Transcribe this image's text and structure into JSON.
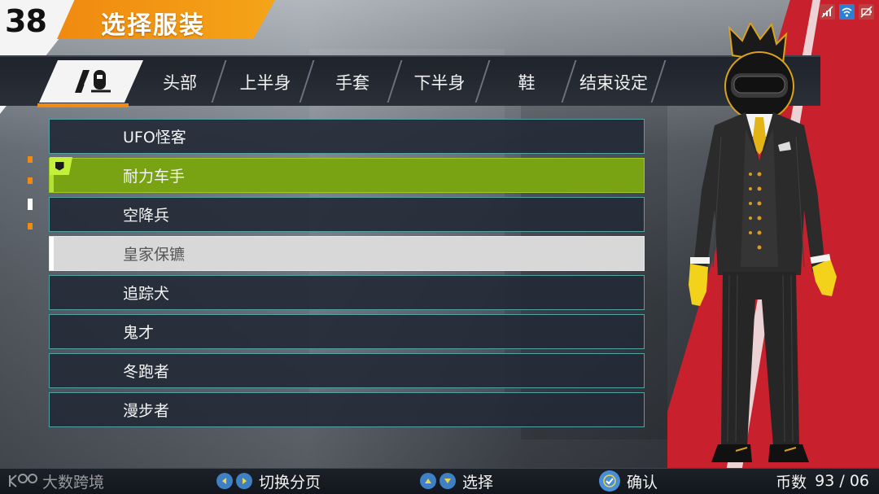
{
  "header": {
    "level": "38",
    "title": "选择服装"
  },
  "status_icons": [
    {
      "name": "signal-off-icon",
      "color": "#b84040"
    },
    {
      "name": "wifi-icon",
      "color": "#2f7fd0"
    },
    {
      "name": "battery-low-icon",
      "color": "#b84040"
    }
  ],
  "tabs": [
    {
      "label": "头部"
    },
    {
      "label": "上半身"
    },
    {
      "label": "手套"
    },
    {
      "label": "下半身"
    },
    {
      "label": "鞋"
    },
    {
      "label": "结束设定"
    }
  ],
  "outfits": [
    {
      "label": "UFO怪客",
      "state": "normal"
    },
    {
      "label": "耐力车手",
      "state": "selected"
    },
    {
      "label": "空降兵",
      "state": "normal"
    },
    {
      "label": "皇家保镳",
      "state": "current"
    },
    {
      "label": "追踪犬",
      "state": "normal"
    },
    {
      "label": "鬼才",
      "state": "normal"
    },
    {
      "label": "冬跑者",
      "state": "normal"
    },
    {
      "label": "漫步者",
      "state": "normal"
    }
  ],
  "footer": {
    "watermark": "大数跨境",
    "switch_page_label": "切换分页",
    "select_label": "选择",
    "confirm_label": "确认",
    "coins_label": "币数",
    "coins_value": "93 / 06"
  },
  "colors": {
    "accent_orange": "#f08a10",
    "selected_green": "#79a312",
    "red_wall": "#c8202c"
  }
}
